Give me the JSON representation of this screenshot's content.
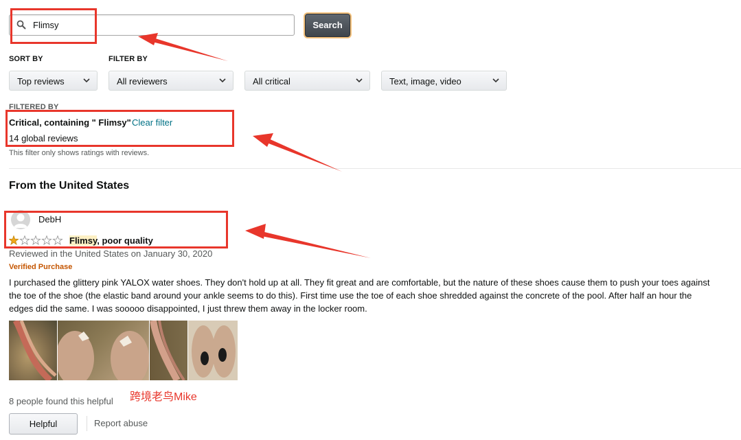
{
  "search": {
    "value": "Flimsy",
    "button_label": "Search"
  },
  "sort": {
    "label": "SORT BY",
    "selected": "Top reviews"
  },
  "filter": {
    "label": "FILTER BY",
    "reviewers": "All reviewers",
    "stars": "All critical",
    "media": "Text, image, video"
  },
  "filtered_by": {
    "label": "FILTERED BY",
    "summary": "Critical, containing \" Flimsy\"",
    "clear": "Clear filter",
    "count": "14 global reviews",
    "note": "This filter only shows ratings with reviews."
  },
  "section_title": "From the United States",
  "review": {
    "author": "DebH",
    "rating": 1,
    "max_rating": 5,
    "title_highlight": "Flimsy",
    "title_rest": ", poor quality",
    "date_line": "Reviewed in the United States on January 30, 2020",
    "verified": "Verified Purchase",
    "body": "I purchased the glittery pink YALOX water shoes. They don't hold up at all. They fit great and are comfortable, but the nature of these shoes cause them to push your toes against the toe of the shoe (the elastic band around your ankle seems to do this). First time use the toe of each shoe shredded against the concrete of the pool. After half an hour the edges did the same. I was sooooo disappointed, I just threw them away in the locker room.",
    "helpful_count": "8 people found this helpful",
    "helpful_button": "Helpful",
    "report": "Report abuse"
  },
  "watermark": "跨境老鸟Mike",
  "colors": {
    "annotation_red": "#e8362b",
    "link": "#007185",
    "verified": "#c45500",
    "star": "#f0a81a",
    "highlight": "#fdf0c4"
  }
}
